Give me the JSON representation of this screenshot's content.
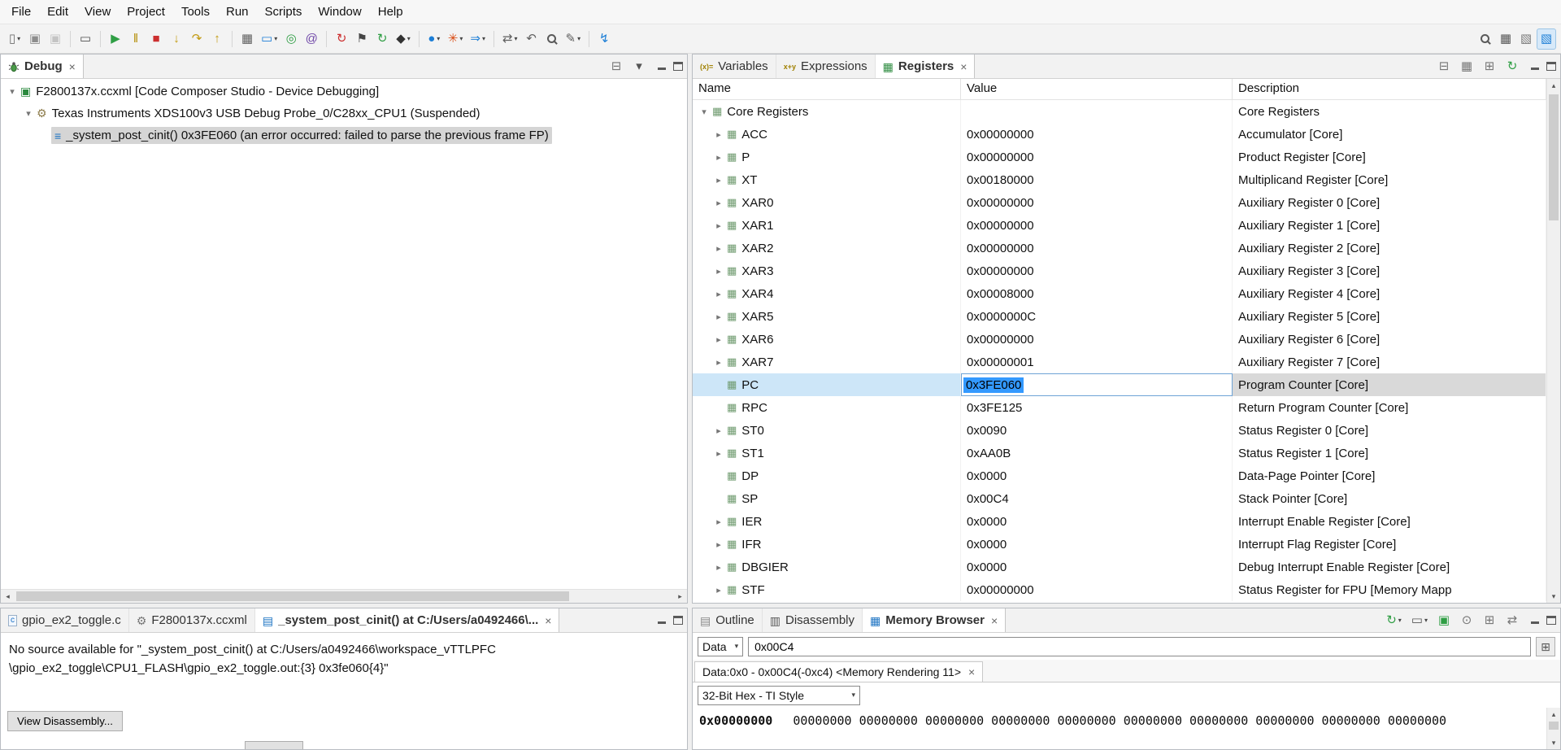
{
  "menubar": {
    "items": [
      "File",
      "Edit",
      "View",
      "Project",
      "Tools",
      "Run",
      "Scripts",
      "Window",
      "Help"
    ]
  },
  "toolbar": {
    "left": [
      {
        "name": "new-file-icon",
        "glyph": "▯",
        "color": "#6d6d6d",
        "caret": true
      },
      {
        "name": "save-icon",
        "glyph": "▣",
        "color": "#8d8d8d"
      },
      {
        "name": "save-all-icon",
        "glyph": "▣",
        "color": "#c4c4c4"
      },
      {
        "sep": true
      },
      {
        "name": "console-icon",
        "glyph": "▭",
        "color": "#4f4f4f"
      },
      {
        "sep": true
      },
      {
        "name": "resume-icon",
        "glyph": "▶",
        "color": "#2f9e44"
      },
      {
        "name": "suspend-icon",
        "glyph": "‖",
        "color": "#b28b00"
      },
      {
        "name": "terminate-icon",
        "glyph": "■",
        "color": "#cc2f2f"
      },
      {
        "name": "step-into-icon",
        "glyph": "↓",
        "color": "#c29a10"
      },
      {
        "name": "step-over-icon",
        "glyph": "↷",
        "color": "#c29a10"
      },
      {
        "name": "step-return-icon",
        "glyph": "↑",
        "color": "#c29a10"
      },
      {
        "sep": true
      },
      {
        "name": "view-grid-icon",
        "glyph": "▦",
        "color": "#5f5f5f"
      },
      {
        "name": "screen-capture-icon",
        "glyph": "▭",
        "color": "#1c7ed6",
        "caret": true
      },
      {
        "name": "target-icon",
        "glyph": "◎",
        "color": "#2f9e44"
      },
      {
        "name": "memory-at-icon",
        "glyph": "@",
        "color": "#7048a8"
      },
      {
        "sep": true
      },
      {
        "name": "reset-icon",
        "glyph": "↻",
        "color": "#cc2f2f"
      },
      {
        "name": "flag-icon",
        "glyph": "⚑",
        "color": "#444444"
      },
      {
        "name": "restart-icon",
        "glyph": "↻",
        "color": "#2f9e44"
      },
      {
        "name": "tools-icon",
        "glyph": "◆",
        "color": "#333333",
        "caret": true
      },
      {
        "sep": true
      },
      {
        "name": "breakpoint-icon",
        "glyph": "●",
        "color": "#1c7ed6",
        "caret": true
      },
      {
        "name": "highlight-icon",
        "glyph": "✳",
        "color": "#d9480f",
        "caret": true
      },
      {
        "name": "step-mode-icon",
        "glyph": "⇒",
        "color": "#1c7ed6",
        "caret": true
      },
      {
        "sep": true
      },
      {
        "name": "trace-icon",
        "glyph": "⇄",
        "color": "#5f5f5f",
        "caret": true
      },
      {
        "name": "back-icon",
        "glyph": "↶",
        "color": "#5f5f5f"
      },
      {
        "name": "search-icon",
        "css": "mag"
      },
      {
        "name": "edit-icon",
        "glyph": "✎",
        "color": "#5f5f5f",
        "caret": true
      },
      {
        "sep": true
      },
      {
        "name": "connect-icon",
        "glyph": "↯",
        "color": "#1c7ed6"
      }
    ],
    "right": [
      {
        "name": "search-icon",
        "css": "mag"
      },
      {
        "name": "open-perspective-icon",
        "glyph": "▦",
        "color": "#555555"
      },
      {
        "name": "ccs-edit-perspective-icon",
        "glyph": "▧",
        "color": "#777777"
      },
      {
        "name": "ccs-debug-perspective-icon",
        "glyph": "▧",
        "color": "#1c7ed6",
        "active": true
      }
    ]
  },
  "debug": {
    "tab": "Debug",
    "tools": [
      {
        "name": "remove-all-icon",
        "glyph": "⊟",
        "color": "#777777"
      },
      {
        "name": "view-menu-icon",
        "glyph": "▾",
        "color": "#555555"
      }
    ],
    "nodes": [
      {
        "text": "F2800137x.ccxml [Code Composer Studio - Device Debugging]"
      },
      {
        "text": "Texas Instruments XDS100v3 USB Debug Probe_0/C28xx_CPU1 (Suspended)"
      },
      {
        "text": "_system_post_cinit() 0x3FE060  (an error occurred: failed to parse the previous frame FP)"
      }
    ]
  },
  "registers": {
    "tabs": [
      "Variables",
      "Expressions",
      "Registers"
    ],
    "tools": [
      {
        "name": "collapse-all-icon",
        "glyph": "⊟",
        "color": "#777777"
      },
      {
        "name": "layout-icon",
        "glyph": "▦",
        "color": "#777777"
      },
      {
        "name": "new-register-view-icon",
        "glyph": "⊞",
        "color": "#777777"
      },
      {
        "name": "refresh-icon",
        "glyph": "↻",
        "color": "#2f9e44"
      }
    ],
    "columns": {
      "name": "Name",
      "value": "Value",
      "description": "Description"
    },
    "group": {
      "name": "Core Registers",
      "description": "Core Registers"
    },
    "rows": [
      {
        "name": "ACC",
        "value": "0x00000000",
        "desc": "Accumulator [Core]",
        "exp": true
      },
      {
        "name": "P",
        "value": "0x00000000",
        "desc": "Product Register [Core]",
        "exp": true
      },
      {
        "name": "XT",
        "value": "0x00180000",
        "desc": "Multiplicand Register [Core]",
        "exp": true
      },
      {
        "name": "XAR0",
        "value": "0x00000000",
        "desc": "Auxiliary Register 0 [Core]",
        "exp": true
      },
      {
        "name": "XAR1",
        "value": "0x00000000",
        "desc": "Auxiliary Register 1 [Core]",
        "exp": true
      },
      {
        "name": "XAR2",
        "value": "0x00000000",
        "desc": "Auxiliary Register 2 [Core]",
        "exp": true
      },
      {
        "name": "XAR3",
        "value": "0x00000000",
        "desc": "Auxiliary Register 3 [Core]",
        "exp": true
      },
      {
        "name": "XAR4",
        "value": "0x00008000",
        "desc": "Auxiliary Register 4 [Core]",
        "exp": true
      },
      {
        "name": "XAR5",
        "value": "0x0000000C",
        "desc": "Auxiliary Register 5 [Core]",
        "exp": true
      },
      {
        "name": "XAR6",
        "value": "0x00000000",
        "desc": "Auxiliary Register 6 [Core]",
        "exp": true
      },
      {
        "name": "XAR7",
        "value": "0x00000001",
        "desc": "Auxiliary Register 7 [Core]",
        "exp": true
      },
      {
        "name": "PC",
        "value": "0x3FE060",
        "desc": "Program Counter [Core]",
        "selected": true
      },
      {
        "name": "RPC",
        "value": "0x3FE125",
        "desc": "Return Program Counter [Core]"
      },
      {
        "name": "ST0",
        "value": "0x0090",
        "desc": "Status Register 0 [Core]",
        "exp": true
      },
      {
        "name": "ST1",
        "value": "0xAA0B",
        "desc": "Status Register 1 [Core]",
        "exp": true
      },
      {
        "name": "DP",
        "value": "0x0000",
        "desc": "Data-Page Pointer [Core]"
      },
      {
        "name": "SP",
        "value": "0x00C4",
        "desc": "Stack Pointer [Core]"
      },
      {
        "name": "IER",
        "value": "0x0000",
        "desc": "Interrupt Enable Register [Core]",
        "exp": true
      },
      {
        "name": "IFR",
        "value": "0x0000",
        "desc": "Interrupt Flag Register [Core]",
        "exp": true
      },
      {
        "name": "DBGIER",
        "value": "0x0000",
        "desc": "Debug Interrupt Enable Register [Core]",
        "exp": true
      },
      {
        "name": "STF",
        "value": "0x00000000",
        "desc": "Status Register for FPU [Memory Mapp",
        "exp": true
      }
    ]
  },
  "editor": {
    "tabs": [
      "gpio_ex2_toggle.c",
      "F2800137x.ccxml",
      "_system_post_cinit() at C:/Users/a0492466\\..."
    ],
    "message_line1": "No source available for \"_system_post_cinit() at C:/Users/a0492466\\workspace_vTTLPFC",
    "message_line2": "\\gpio_ex2_toggle\\CPU1_FLASH\\gpio_ex2_toggle.out:{3} 0x3fe060{4}\"",
    "button": "View Disassembly..."
  },
  "memory": {
    "tabs": [
      "Outline",
      "Disassembly",
      "Memory Browser"
    ],
    "tools": [
      {
        "name": "refresh-icon",
        "glyph": "↻",
        "color": "#2f9e44",
        "caret": true
      },
      {
        "name": "screen-icon",
        "glyph": "▭",
        "color": "#555555",
        "caret": true
      },
      {
        "name": "save-memory-icon",
        "glyph": "▣",
        "color": "#2f9e44"
      },
      {
        "name": "pin-icon",
        "glyph": "⊙",
        "color": "#777777"
      },
      {
        "name": "new-tab-icon",
        "glyph": "⊞",
        "color": "#777777"
      },
      {
        "name": "link-icon",
        "glyph": "⇄",
        "color": "#777777"
      }
    ],
    "scope": "Data",
    "address": "0x00C4",
    "rendering_tab": "Data:0x0 - 0x00C4(-0xc4) <Memory Rendering 11>",
    "format": "32-Bit Hex - TI Style",
    "row_address": "0x00000000",
    "row_values": "00000000 00000000 00000000 00000000 00000000 00000000 00000000 00000000 00000000 00000000"
  }
}
